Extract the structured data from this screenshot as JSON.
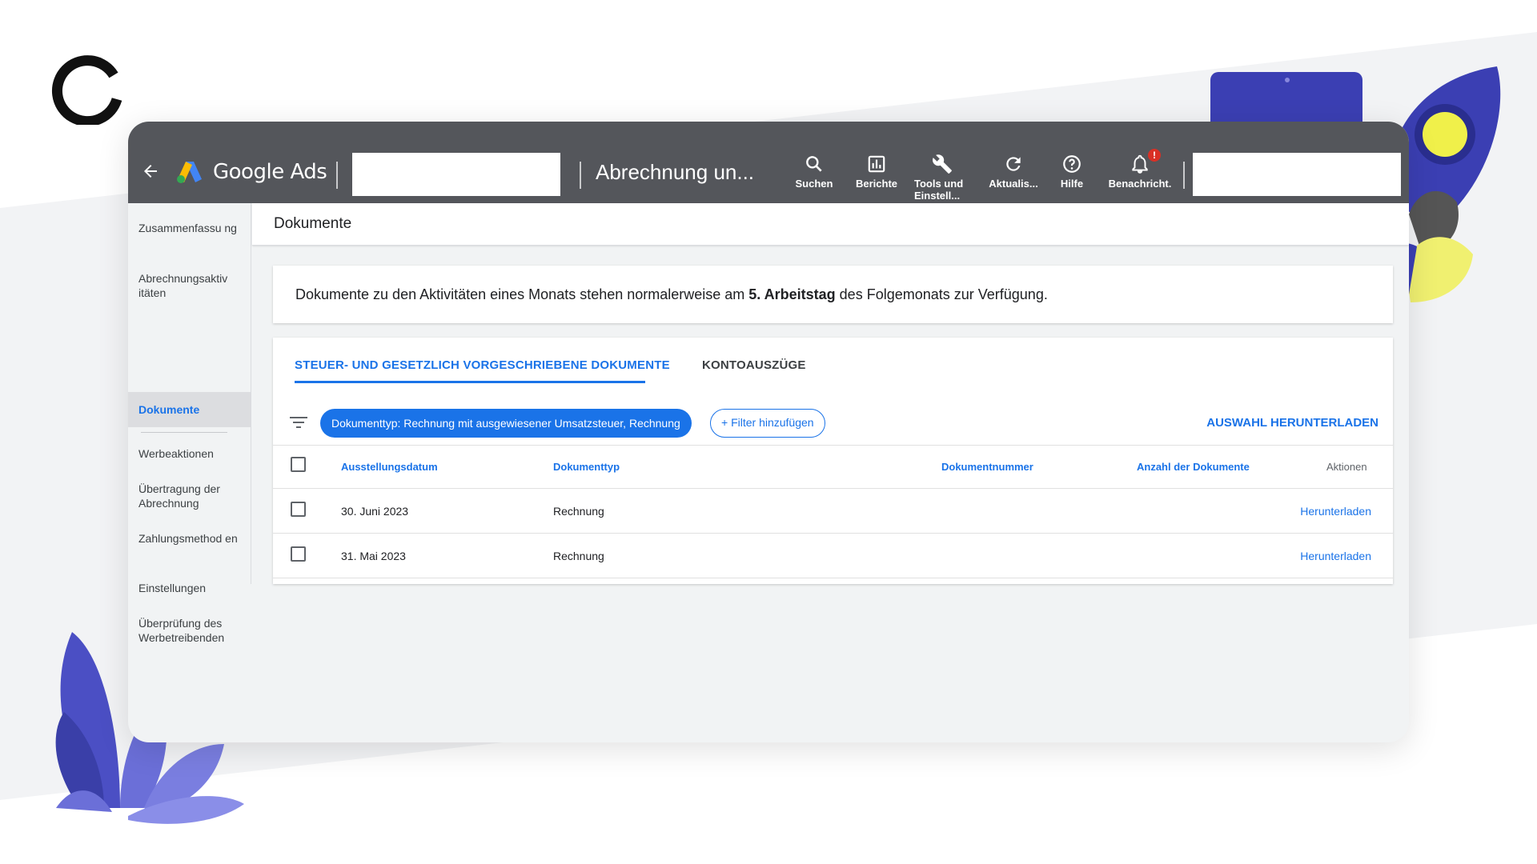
{
  "brand": {
    "product_name": "Google Ads",
    "page_crumb": "Abrechnung un..."
  },
  "toolbar": {
    "items": [
      {
        "label": "Suchen",
        "icon": "search-icon"
      },
      {
        "label": "Berichte",
        "icon": "reports-icon"
      },
      {
        "label": "Tools und",
        "label2": "Einstell...",
        "icon": "wrench-icon"
      },
      {
        "label": "Aktualis...",
        "icon": "refresh-icon"
      },
      {
        "label": "Hilfe",
        "icon": "help-icon"
      },
      {
        "label": "Benachricht.",
        "icon": "bell-icon",
        "badge": "!"
      }
    ]
  },
  "sidebar": {
    "items": [
      {
        "label": "Zusammenfassu ng"
      },
      {
        "label": "Abrechnungsaktiv itäten"
      },
      {
        "label": "Dokumente",
        "active": true
      },
      {
        "label": "Werbeaktionen"
      },
      {
        "label": "Übertragung der Abrechnung"
      },
      {
        "label": "Zahlungsmethod en"
      },
      {
        "label": "Einstellungen"
      },
      {
        "label": "Überprüfung des Werbetreibenden"
      }
    ]
  },
  "content": {
    "title": "Dokumente",
    "info_prefix": "Dokumente zu den Aktivitäten eines Monats stehen normalerweise am ",
    "info_bold": "5. Arbeitstag",
    "info_suffix": " des Folgemonats zur Verfügung.",
    "tabs": [
      {
        "label": "STEUER- UND GESETZLICH VORGESCHRIEBENE DOKUMENTE",
        "active": true
      },
      {
        "label": "KONTOAUSZÜGE",
        "active": false
      }
    ],
    "filter_chip": "Dokumenttyp: Rechnung mit ausgewiesener Umsatzsteuer, Rechnung",
    "add_filter": "+ Filter hinzufügen",
    "download_selection": "AUSWAHL HERUNTERLADEN",
    "columns": [
      "Ausstellungsdatum",
      "Dokumenttyp",
      "Dokumentnummer",
      "Anzahl der Dokumente",
      "Aktionen"
    ],
    "rows": [
      {
        "date": "30. Juni 2023",
        "type": "Rechnung",
        "number": "",
        "count": "",
        "action": "Herunterladen"
      },
      {
        "date": "31. Mai 2023",
        "type": "Rechnung",
        "number": "",
        "count": "",
        "action": "Herunterladen"
      }
    ]
  },
  "colors": {
    "topbar": "#54565b",
    "accent": "#1a73e8",
    "deco_purple": "#3f3fb0",
    "deco_yellow": "#f4f45a"
  }
}
